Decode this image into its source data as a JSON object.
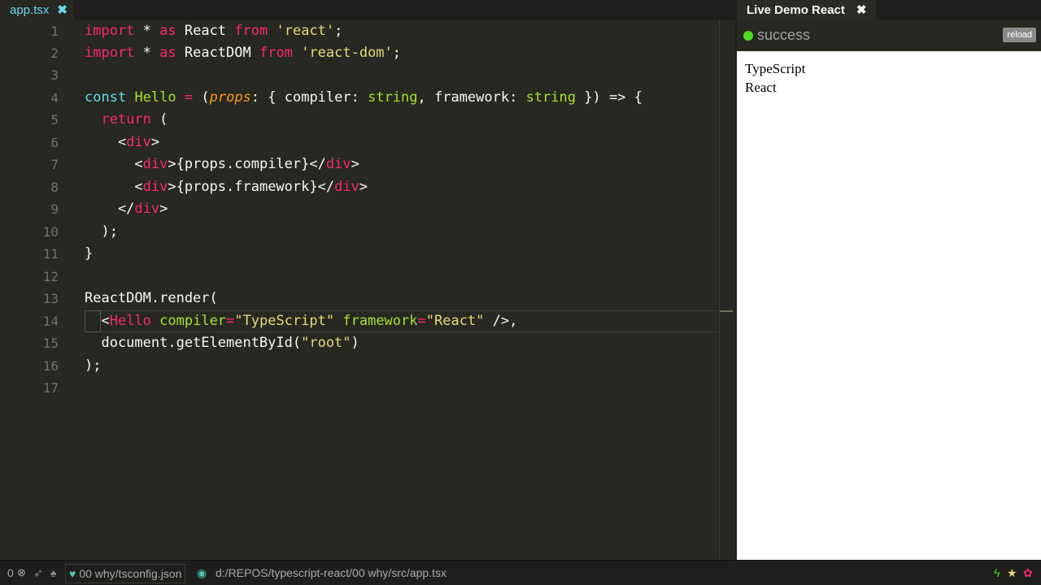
{
  "editor": {
    "tab": {
      "label": "app.tsx",
      "close": "✖"
    },
    "lines": [
      {
        "n": "1"
      },
      {
        "n": "2"
      },
      {
        "n": "3"
      },
      {
        "n": "4"
      },
      {
        "n": "5"
      },
      {
        "n": "6"
      },
      {
        "n": "7"
      },
      {
        "n": "8"
      },
      {
        "n": "9"
      },
      {
        "n": "10"
      },
      {
        "n": "11"
      },
      {
        "n": "12"
      },
      {
        "n": "13"
      },
      {
        "n": "14"
      },
      {
        "n": "15"
      },
      {
        "n": "16"
      },
      {
        "n": "17"
      }
    ],
    "code": {
      "l1": [
        "import",
        " * ",
        "as",
        " React ",
        "from",
        " ",
        "'react'",
        ";"
      ],
      "l2": [
        "import",
        " * ",
        "as",
        " ReactDOM ",
        "from",
        " ",
        "'react-dom'",
        ";"
      ],
      "l4": [
        "const",
        " ",
        "Hello",
        " ",
        "=",
        " (",
        "props",
        ": { compiler: ",
        "string",
        ", framework: ",
        "string",
        " }) => {"
      ],
      "l5": [
        "  ",
        "return",
        " ("
      ],
      "l6": [
        "    <",
        "div",
        ">"
      ],
      "l7": [
        "      <",
        "div",
        ">{props.compiler}</",
        "div",
        ">"
      ],
      "l8": [
        "      <",
        "div",
        ">{props.framework}</",
        "div",
        ">"
      ],
      "l9": [
        "    </",
        "div",
        ">"
      ],
      "l10": [
        "  );"
      ],
      "l11": [
        "}"
      ],
      "l13": [
        "ReactDOM.render("
      ],
      "l14": [
        "  <",
        "Hello",
        " ",
        "compiler",
        "=",
        "\"TypeScript\"",
        " ",
        "framework",
        "=",
        "\"React\"",
        " />,"
      ],
      "l15": [
        "  document.getElementById(",
        "\"root\"",
        ")"
      ],
      "l16": [
        ");"
      ]
    }
  },
  "preview": {
    "tab": {
      "label": "Live Demo React",
      "close": "✖"
    },
    "status": "success",
    "reload_label": "reload",
    "content": [
      "TypeScript",
      "React"
    ]
  },
  "statusbar": {
    "count": "0",
    "tsconfig": "00 why/tsconfig.json",
    "path": "d:/REPOS/typescript-react/00 why/src/app.tsx"
  },
  "colors": {
    "background": "#272822",
    "keyword": "#f92672",
    "string": "#e6db74",
    "function": "#a6e22e",
    "builtin": "#66d9ef",
    "param": "#fd971f",
    "success": "#4cdc1c"
  }
}
